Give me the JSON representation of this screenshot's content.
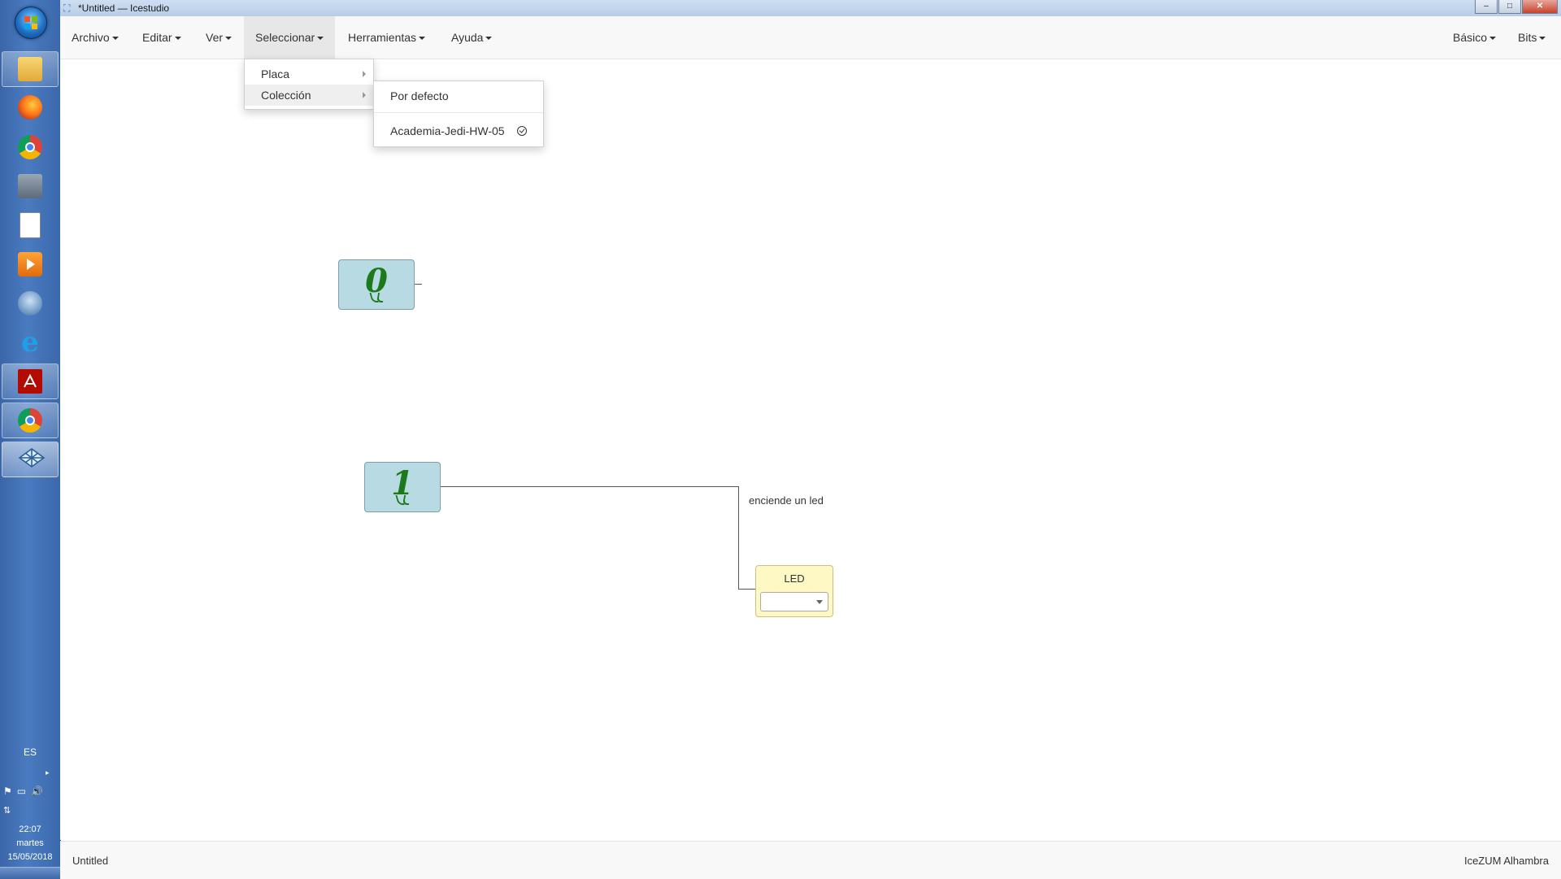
{
  "window": {
    "title": "*Untitled — Icestudio",
    "minimize_glyph": "–",
    "maximize_glyph": "□",
    "close_glyph": "✕"
  },
  "menubar": {
    "items": [
      {
        "label": "Archivo"
      },
      {
        "label": "Editar"
      },
      {
        "label": "Ver"
      },
      {
        "label": "Seleccionar",
        "active": true
      },
      {
        "label": "Herramientas"
      },
      {
        "label": "Ayuda"
      }
    ],
    "right_items": [
      {
        "label": "Básico"
      },
      {
        "label": "Bits"
      }
    ]
  },
  "select_menu": {
    "items": [
      {
        "label": "Placa",
        "has_submenu": true
      },
      {
        "label": "Colección",
        "has_submenu": true,
        "highlighted": true
      }
    ]
  },
  "collection_submenu": {
    "items": [
      {
        "label": "Por defecto",
        "checked": false
      },
      {
        "label": "Academia-Jedi-HW-05",
        "checked": true
      }
    ]
  },
  "canvas": {
    "const_blocks": [
      {
        "value": "0"
      },
      {
        "value": "1"
      }
    ],
    "comment": "enciende un led",
    "led_block": {
      "name": "LED",
      "selected_pin": ""
    }
  },
  "footer": {
    "left": "Untitled",
    "right": "IceZUM Alhambra"
  },
  "taskbar": {
    "language": "ES",
    "time": "22:07",
    "day": "martes",
    "date": "15/05/2018",
    "pinned_apps": [
      "windows-explorer-icon",
      "firefox-icon",
      "chrome-icon",
      "file-manager-icon",
      "document-icon",
      "media-player-icon",
      "thunderbird-icon",
      "internet-explorer-icon",
      "acrobat-pdf-icon",
      "chrome-icon",
      "icestudio-icon"
    ],
    "colors": {
      "bar": "#4a7bc0"
    }
  },
  "colors": {
    "const_block_fill": "#b8dae3",
    "const_digit": "#1c7a1c",
    "led_block_fill": "#fdf8c4",
    "menubar_bg": "#f8f8f8"
  }
}
